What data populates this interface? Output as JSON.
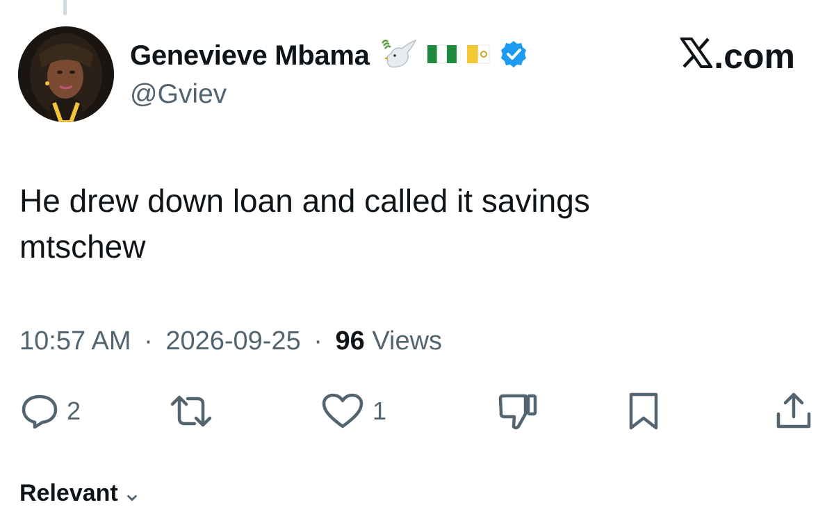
{
  "author": {
    "display_name": "Genevieve Mbama",
    "handle": "@Gviev",
    "badges": [
      "dove-emoji",
      "nigeria-flag-emoji",
      "vatican-flag-emoji",
      "verified-badge-icon"
    ]
  },
  "brand": {
    "label": ".com",
    "icon": "x-logo-icon"
  },
  "tweet": {
    "lines": [
      "He drew down loan and called it savings",
      "mtschew"
    ]
  },
  "meta": {
    "time": "10:57 AM",
    "separator": "·",
    "date": "2026-09-25",
    "views_count": "96",
    "views_label": "Views"
  },
  "actions": {
    "reply_count": "2",
    "like_count": "1"
  },
  "sort": {
    "label": "Relevant",
    "chevron": "⌄"
  },
  "colors": {
    "text": "#0f1419",
    "muted": "#536471",
    "verified": "#1d9bf0",
    "divider": "#cfd9de"
  }
}
